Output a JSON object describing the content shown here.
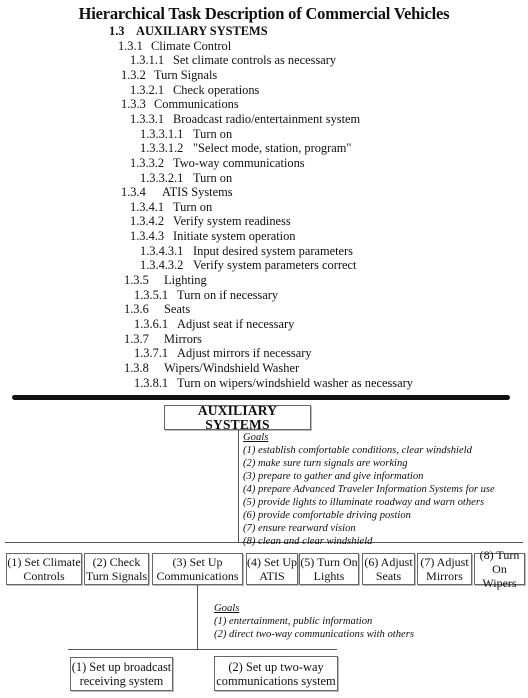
{
  "title": "Hierarchical Task Description of Commercial Vehicles",
  "outline": [
    {
      "num": "1.3",
      "text": "AUXILIARY SYSTEMS",
      "level": 1
    },
    {
      "num": "1.3.1",
      "text": "Climate Control",
      "level": 2
    },
    {
      "num": "1.3.1.1",
      "text": "Set climate controls as necessary",
      "level": 3
    },
    {
      "num": "1.3.2",
      "text": "Turn Signals",
      "level": 2
    },
    {
      "num": "1.3.2.1",
      "text": "Check operations",
      "level": 3
    },
    {
      "num": "1.3.3",
      "text": "Communications",
      "level": 2
    },
    {
      "num": "1.3.3.1",
      "text": "Broadcast radio/entertainment system",
      "level": 3
    },
    {
      "num": "1.3.3.1.1",
      "text": "Turn on",
      "level": 4
    },
    {
      "num": "1.3.3.1.2",
      "text": "\"Select mode, station, program\"",
      "level": 4
    },
    {
      "num": "1.3.3.2",
      "text": "Two-way communications",
      "level": 3
    },
    {
      "num": "1.3.3.2.1",
      "text": "Turn on",
      "level": 4
    },
    {
      "num": "1.3.4",
      "text": "ATIS Systems",
      "level": 2
    },
    {
      "num": "1.3.4.1",
      "text": "Turn on",
      "level": 3
    },
    {
      "num": "1.3.4.2",
      "text": "Verify system readiness",
      "level": 3
    },
    {
      "num": "1.3.4.3",
      "text": "Initiate system operation",
      "level": 3
    },
    {
      "num": "1.3.4.3.1",
      "text": "Input desired system parameters",
      "level": 4
    },
    {
      "num": "1.3.4.3.2",
      "text": "Verify system parameters correct",
      "level": 4
    },
    {
      "num": "1.3.5",
      "text": "Lighting",
      "level": 2
    },
    {
      "num": "1.3.5.1",
      "text": "Turn on if necessary",
      "level": 3
    },
    {
      "num": "1.3.6",
      "text": "Seats",
      "level": 2
    },
    {
      "num": "1.3.6.1",
      "text": "Adjust seat if necessary",
      "level": 3
    },
    {
      "num": "1.3.7",
      "text": "Mirrors",
      "level": 2
    },
    {
      "num": "1.3.7.1",
      "text": "Adjust mirrors if necessary",
      "level": 3
    },
    {
      "num": "1.3.8",
      "text": "Wipers/Windshield Washer",
      "level": 2
    },
    {
      "num": "1.3.8.1",
      "text": "Turn on wipers/windshield washer as necessary",
      "level": 3
    }
  ],
  "diagram": {
    "root": "AUXILIARY SYSTEMS",
    "root_goals": {
      "heading": "Goals",
      "items": [
        "(1) establish comfortable conditions, clear windshield",
        "(2) make sure turn signals are working",
        "(3) prepare to gather and give information",
        "(4) prepare Advanced Traveler Information Systems for use",
        "(5) provide lights to illuminate roadway and warn others",
        "(6) provide comfortable driving postion",
        "(7) ensure rearward vision",
        "(8) clean and clear windshield"
      ]
    },
    "children": [
      {
        "line1": "(1) Set Climate",
        "line2": "Controls"
      },
      {
        "line1": "(2) Check",
        "line2": "Turn Signals"
      },
      {
        "line1": "(3) Set Up",
        "line2": "Communications"
      },
      {
        "line1": "(4) Set Up",
        "line2": "ATIS"
      },
      {
        "line1": "(5) Turn On",
        "line2": "Lights"
      },
      {
        "line1": "(6) Adjust",
        "line2": "Seats"
      },
      {
        "line1": "(7) Adjust",
        "line2": "Mirrors"
      },
      {
        "line1": "(8) Turn",
        "line2": "On Wipers"
      }
    ],
    "comm_goals": {
      "heading": "Goals",
      "items": [
        "(1) entertainment, public information",
        "(2) direct two-way communications with others"
      ]
    },
    "comm_children": [
      {
        "line1": "(1) Set up broadcast",
        "line2": "receiving system"
      },
      {
        "line1": "(2) Set up two-way",
        "line2": "communications system"
      }
    ]
  }
}
